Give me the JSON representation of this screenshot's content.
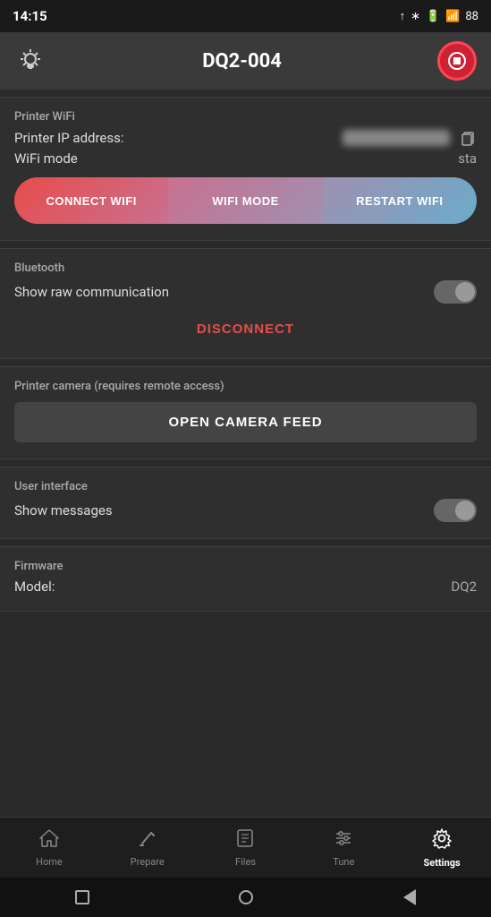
{
  "statusBar": {
    "time": "14:15",
    "upload_icon": "↑",
    "battery": "88"
  },
  "topBar": {
    "title": "DQ2-004",
    "stop_label": "STOP"
  },
  "wifi": {
    "section_title": "Printer WiFi",
    "ip_label": "Printer IP address:",
    "ip_value": "192.168.1.xxx",
    "mode_label": "WiFi mode",
    "mode_value": "sta",
    "btn_connect": "CONNECT WIFI",
    "btn_mode": "WIFI MODE",
    "btn_restart": "RESTART WIFI"
  },
  "bluetooth": {
    "section_title": "Bluetooth",
    "raw_comm_label": "Show raw communication",
    "disconnect_label": "DISCONNECT"
  },
  "camera": {
    "section_title": "Printer camera (requires remote access)",
    "open_feed_label": "OPEN CAMERA FEED"
  },
  "ui": {
    "section_title": "User interface",
    "messages_label": "Show messages"
  },
  "firmware": {
    "section_title": "Firmware",
    "model_label": "Model:",
    "model_value": "DQ2"
  },
  "bottomNav": {
    "items": [
      {
        "label": "Home",
        "icon": "⌂",
        "active": false
      },
      {
        "label": "Prepare",
        "icon": "✎",
        "active": false
      },
      {
        "label": "Files",
        "icon": "▦",
        "active": false
      },
      {
        "label": "Tune",
        "icon": "≡",
        "active": false
      },
      {
        "label": "Settings",
        "icon": "⚙",
        "active": true
      }
    ]
  }
}
